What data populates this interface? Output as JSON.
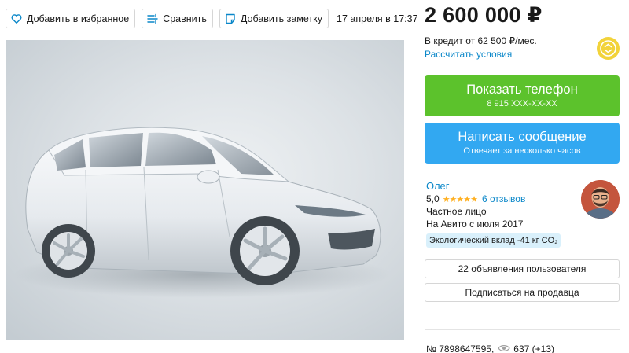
{
  "toolbar": {
    "favorite_label": "Добавить в избранное",
    "compare_label": "Сравнить",
    "note_label": "Добавить заметку",
    "date": "17 апреля в 17:37"
  },
  "listing": {
    "price": "2 600 000 ₽",
    "credit_text": "В кредит от 62 500 ₽/мес.",
    "credit_link": "Рассчитать условия"
  },
  "contact": {
    "phone_title": "Показать телефон",
    "phone_number": "8 915 XXX-XX-XX",
    "message_title": "Написать сообщение",
    "message_sub": "Отвечает за несколько часов"
  },
  "seller": {
    "name": "Олег",
    "rating": "5,0",
    "stars": "★★★★★",
    "reviews": "6 отзывов",
    "type": "Частное лицо",
    "since": "На Авито с июля 2017",
    "eco": "Экологический вклад -41 кг CO₂",
    "ads_button": "22 объявления пользователя",
    "subscribe_button": "Подписаться на продавца"
  },
  "meta": {
    "number": "№ 7898647595,",
    "views": "637 (+13)"
  },
  "colors": {
    "green": "#5cc22c",
    "blue": "#32a8f1",
    "link": "#0a87c9",
    "star": "#ffb021"
  }
}
